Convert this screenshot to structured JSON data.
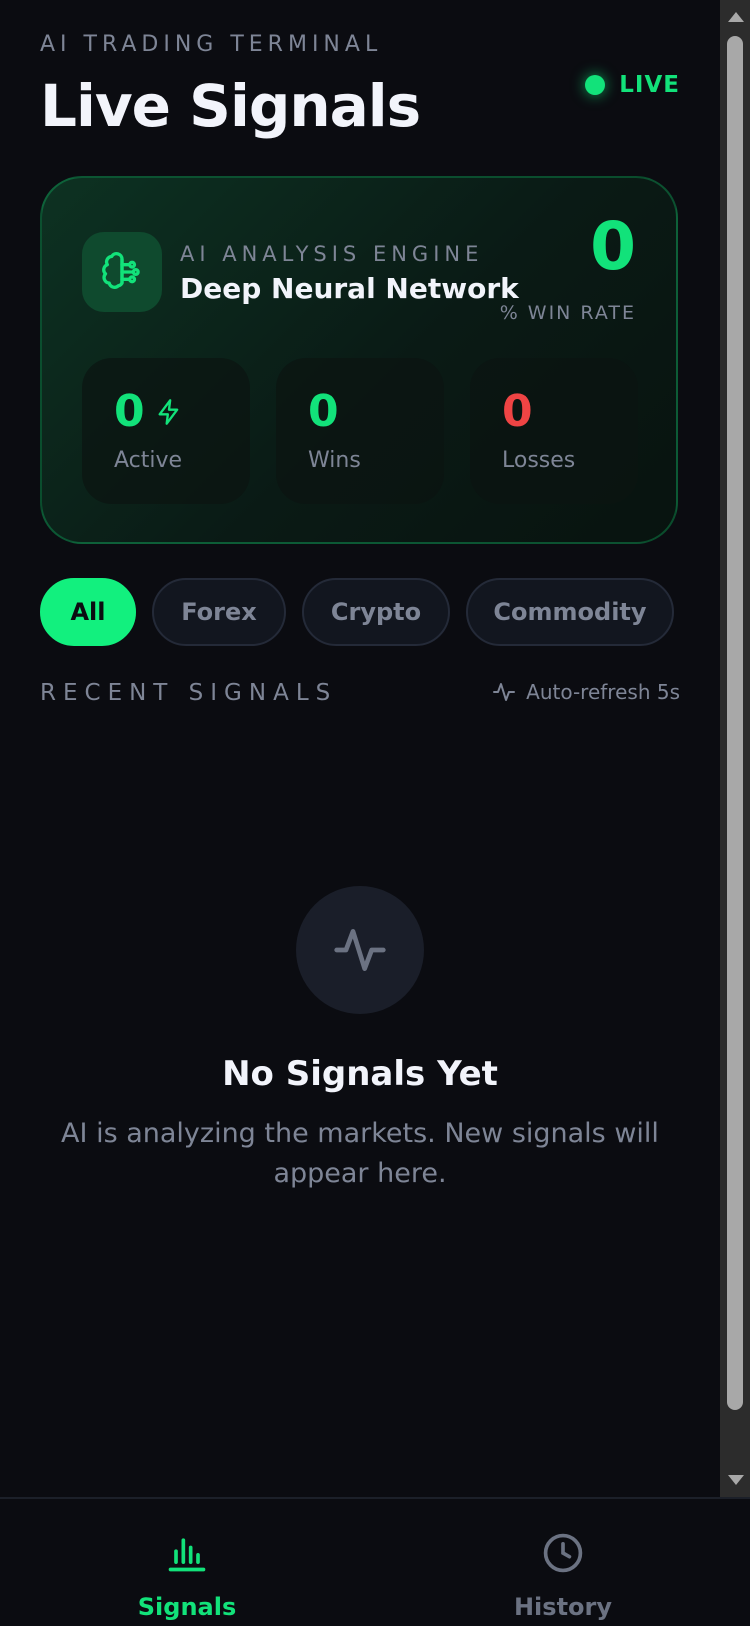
{
  "header": {
    "eyebrow": "AI TRADING TERMINAL",
    "title": "Live Signals",
    "live_label": "LIVE"
  },
  "engine": {
    "subtitle": "AI ANALYSIS ENGINE",
    "name": "Deep Neural Network",
    "win_rate_value": "0",
    "win_rate_label": "% WIN RATE",
    "icon": "brain-icon",
    "stats": [
      {
        "value": "0",
        "label": "Active",
        "icon": "lightning-icon"
      },
      {
        "value": "0",
        "label": "Wins"
      },
      {
        "value": "0",
        "label": "Losses"
      }
    ]
  },
  "filters": [
    {
      "label": "All",
      "selected": true
    },
    {
      "label": "Forex"
    },
    {
      "label": "Crypto"
    },
    {
      "label": "Commodity"
    }
  ],
  "section": {
    "title": "RECENT SIGNALS",
    "autorefresh": "Auto-refresh 5s",
    "autorefresh_icon": "activity-icon"
  },
  "empty_state": {
    "icon": "activity-icon",
    "title": "No Signals Yet",
    "text": "AI is analyzing the markets. New signals will appear here."
  },
  "nav": [
    {
      "label": "Signals",
      "icon": "bar-chart-icon",
      "active": true
    },
    {
      "label": "History",
      "icon": "clock-icon"
    }
  ],
  "colors": {
    "accent": "#12e27a",
    "loss": "#ef4444",
    "background": "#0b0c11",
    "muted": "#7e8596"
  }
}
